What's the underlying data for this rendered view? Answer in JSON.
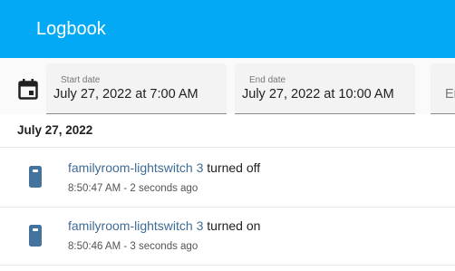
{
  "header": {
    "title": "Logbook"
  },
  "filters": {
    "start_date": {
      "label": "Start date",
      "value": "July 27, 2022 at 7:00 AM"
    },
    "end_date": {
      "label": "End date",
      "value": "July 27, 2022 at 10:00 AM"
    },
    "entity_partial": "En"
  },
  "day": {
    "label": "July 27, 2022"
  },
  "entries": [
    {
      "entity": "familyroom-lightswitch 3",
      "action": " turned off",
      "time": "8:50:47 AM",
      "separator": " - ",
      "relative": "2 seconds ago"
    },
    {
      "entity": "familyroom-lightswitch 3",
      "action": " turned on",
      "time": "8:50:46 AM",
      "separator": " - ",
      "relative": "3 seconds ago"
    }
  ],
  "colors": {
    "header": "#03a9f4",
    "link": "#3f6b96",
    "icon": "#44739e"
  },
  "icons": {
    "date": "calendar-icon",
    "entry": "light-switch-icon"
  }
}
